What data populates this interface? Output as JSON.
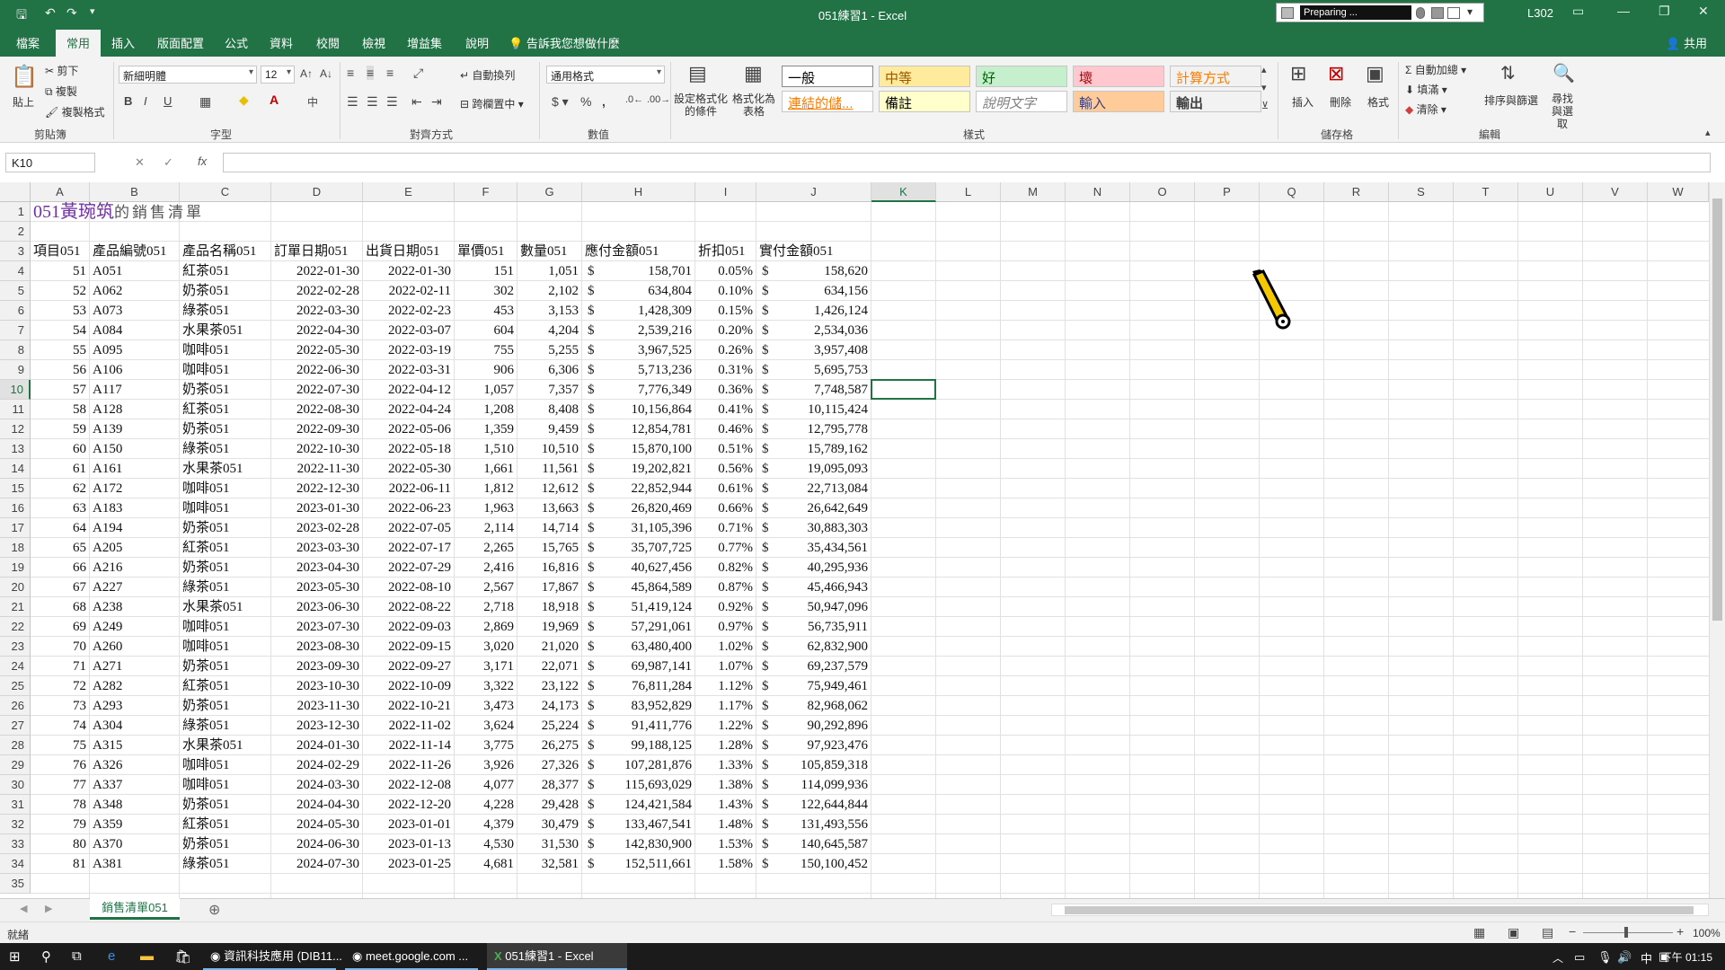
{
  "titlebar": {
    "title": "051練習1 - Excel",
    "preparing": "Preparing ...",
    "user": "L302"
  },
  "tabs": [
    "檔案",
    "常用",
    "插入",
    "版面配置",
    "公式",
    "資料",
    "校閱",
    "檢視",
    "增益集",
    "說明"
  ],
  "tell_me": "告訴我您想做什麼",
  "share": "共用",
  "ribbon": {
    "clipboard": {
      "label": "剪貼簿",
      "paste": "貼上",
      "cut": "剪下",
      "copy": "複製",
      "format_painter": "複製格式"
    },
    "font": {
      "label": "字型",
      "font_name": "新細明體",
      "font_size": "12"
    },
    "alignment": {
      "label": "對齊方式",
      "wrap": "自動換列",
      "merge": "跨欄置中"
    },
    "number": {
      "label": "數值",
      "format": "通用格式"
    },
    "styles": {
      "label": "樣式",
      "conditional": "設定格式化的條件",
      "as_table": "格式化為表格",
      "cells": [
        {
          "text": "一般",
          "bg": "#ffffff",
          "fg": "#000000"
        },
        {
          "text": "中等",
          "bg": "#ffeb9c",
          "fg": "#9c5700"
        },
        {
          "text": "好",
          "bg": "#c6efce",
          "fg": "#006100"
        },
        {
          "text": "壞",
          "bg": "#ffc7ce",
          "fg": "#9c0006"
        },
        {
          "text": "計算方式",
          "bg": "#f2f2f2",
          "fg": "#fa7d00"
        },
        {
          "text": "連結的儲...",
          "bg": "#ffffff",
          "fg": "#fa7d00"
        },
        {
          "text": "備註",
          "bg": "#ffffcc",
          "fg": "#000000"
        },
        {
          "text": "說明文字",
          "bg": "#ffffff",
          "fg": "#7f7f7f"
        },
        {
          "text": "輸入",
          "bg": "#ffcc99",
          "fg": "#3f3f76"
        },
        {
          "text": "輸出",
          "bg": "#f2f2f2",
          "fg": "#3f3f3f"
        }
      ]
    },
    "cells_group": {
      "label": "儲存格",
      "insert": "插入",
      "delete": "刪除",
      "format": "格式"
    },
    "editing": {
      "label": "編輯",
      "autosum": "自動加總",
      "fill": "填滿",
      "clear": "清除",
      "sort": "排序與篩選",
      "find": "尋找與選取"
    }
  },
  "formula_bar": {
    "name_box": "K10",
    "fx": "fx",
    "content": ""
  },
  "columns": [
    "A",
    "B",
    "C",
    "D",
    "E",
    "F",
    "G",
    "H",
    "I",
    "J",
    "K",
    "L",
    "M",
    "N",
    "O",
    "P",
    "Q",
    "R",
    "S",
    "T",
    "U",
    "V",
    "W"
  ],
  "sheet": {
    "title": "051黃琬筑",
    "title_suffix": "的銷售清單",
    "headers": [
      "項目051",
      "產品編號051",
      "產品名稱051",
      "訂單日期051",
      "出貨日期051",
      "單價051",
      "數量051",
      "應付金額051",
      "折扣051",
      "實付金額051"
    ],
    "currency": "$",
    "rows": [
      [
        "51",
        "A051",
        "紅茶051",
        "2022-01-30",
        "2022-01-30",
        "151",
        "1,051",
        "158,701",
        "0.05%",
        "158,620"
      ],
      [
        "52",
        "A062",
        "奶茶051",
        "2022-02-28",
        "2022-02-11",
        "302",
        "2,102",
        "634,804",
        "0.10%",
        "634,156"
      ],
      [
        "53",
        "A073",
        "綠茶051",
        "2022-03-30",
        "2022-02-23",
        "453",
        "3,153",
        "1,428,309",
        "0.15%",
        "1,426,124"
      ],
      [
        "54",
        "A084",
        "水果茶051",
        "2022-04-30",
        "2022-03-07",
        "604",
        "4,204",
        "2,539,216",
        "0.20%",
        "2,534,036"
      ],
      [
        "55",
        "A095",
        "咖啡051",
        "2022-05-30",
        "2022-03-19",
        "755",
        "5,255",
        "3,967,525",
        "0.26%",
        "3,957,408"
      ],
      [
        "56",
        "A106",
        "咖啡051",
        "2022-06-30",
        "2022-03-31",
        "906",
        "6,306",
        "5,713,236",
        "0.31%",
        "5,695,753"
      ],
      [
        "57",
        "A117",
        "奶茶051",
        "2022-07-30",
        "2022-04-12",
        "1,057",
        "7,357",
        "7,776,349",
        "0.36%",
        "7,748,587"
      ],
      [
        "58",
        "A128",
        "紅茶051",
        "2022-08-30",
        "2022-04-24",
        "1,208",
        "8,408",
        "10,156,864",
        "0.41%",
        "10,115,424"
      ],
      [
        "59",
        "A139",
        "奶茶051",
        "2022-09-30",
        "2022-05-06",
        "1,359",
        "9,459",
        "12,854,781",
        "0.46%",
        "12,795,778"
      ],
      [
        "60",
        "A150",
        "綠茶051",
        "2022-10-30",
        "2022-05-18",
        "1,510",
        "10,510",
        "15,870,100",
        "0.51%",
        "15,789,162"
      ],
      [
        "61",
        "A161",
        "水果茶051",
        "2022-11-30",
        "2022-05-30",
        "1,661",
        "11,561",
        "19,202,821",
        "0.56%",
        "19,095,093"
      ],
      [
        "62",
        "A172",
        "咖啡051",
        "2022-12-30",
        "2022-06-11",
        "1,812",
        "12,612",
        "22,852,944",
        "0.61%",
        "22,713,084"
      ],
      [
        "63",
        "A183",
        "咖啡051",
        "2023-01-30",
        "2022-06-23",
        "1,963",
        "13,663",
        "26,820,469",
        "0.66%",
        "26,642,649"
      ],
      [
        "64",
        "A194",
        "奶茶051",
        "2023-02-28",
        "2022-07-05",
        "2,114",
        "14,714",
        "31,105,396",
        "0.71%",
        "30,883,303"
      ],
      [
        "65",
        "A205",
        "紅茶051",
        "2023-03-30",
        "2022-07-17",
        "2,265",
        "15,765",
        "35,707,725",
        "0.77%",
        "35,434,561"
      ],
      [
        "66",
        "A216",
        "奶茶051",
        "2023-04-30",
        "2022-07-29",
        "2,416",
        "16,816",
        "40,627,456",
        "0.82%",
        "40,295,936"
      ],
      [
        "67",
        "A227",
        "綠茶051",
        "2023-05-30",
        "2022-08-10",
        "2,567",
        "17,867",
        "45,864,589",
        "0.87%",
        "45,466,943"
      ],
      [
        "68",
        "A238",
        "水果茶051",
        "2023-06-30",
        "2022-08-22",
        "2,718",
        "18,918",
        "51,419,124",
        "0.92%",
        "50,947,096"
      ],
      [
        "69",
        "A249",
        "咖啡051",
        "2023-07-30",
        "2022-09-03",
        "2,869",
        "19,969",
        "57,291,061",
        "0.97%",
        "56,735,911"
      ],
      [
        "70",
        "A260",
        "咖啡051",
        "2023-08-30",
        "2022-09-15",
        "3,020",
        "21,020",
        "63,480,400",
        "1.02%",
        "62,832,900"
      ],
      [
        "71",
        "A271",
        "奶茶051",
        "2023-09-30",
        "2022-09-27",
        "3,171",
        "22,071",
        "69,987,141",
        "1.07%",
        "69,237,579"
      ],
      [
        "72",
        "A282",
        "紅茶051",
        "2023-10-30",
        "2022-10-09",
        "3,322",
        "23,122",
        "76,811,284",
        "1.12%",
        "75,949,461"
      ],
      [
        "73",
        "A293",
        "奶茶051",
        "2023-11-30",
        "2022-10-21",
        "3,473",
        "24,173",
        "83,952,829",
        "1.17%",
        "82,968,062"
      ],
      [
        "74",
        "A304",
        "綠茶051",
        "2023-12-30",
        "2022-11-02",
        "3,624",
        "25,224",
        "91,411,776",
        "1.22%",
        "90,292,896"
      ],
      [
        "75",
        "A315",
        "水果茶051",
        "2024-01-30",
        "2022-11-14",
        "3,775",
        "26,275",
        "99,188,125",
        "1.28%",
        "97,923,476"
      ],
      [
        "76",
        "A326",
        "咖啡051",
        "2024-02-29",
        "2022-11-26",
        "3,926",
        "27,326",
        "107,281,876",
        "1.33%",
        "105,859,318"
      ],
      [
        "77",
        "A337",
        "咖啡051",
        "2024-03-30",
        "2022-12-08",
        "4,077",
        "28,377",
        "115,693,029",
        "1.38%",
        "114,099,936"
      ],
      [
        "78",
        "A348",
        "奶茶051",
        "2024-04-30",
        "2022-12-20",
        "4,228",
        "29,428",
        "124,421,584",
        "1.43%",
        "122,644,844"
      ],
      [
        "79",
        "A359",
        "紅茶051",
        "2024-05-30",
        "2023-01-01",
        "4,379",
        "30,479",
        "133,467,541",
        "1.48%",
        "131,493,556"
      ],
      [
        "80",
        "A370",
        "奶茶051",
        "2024-06-30",
        "2023-01-13",
        "4,530",
        "31,530",
        "142,830,900",
        "1.53%",
        "140,645,587"
      ],
      [
        "81",
        "A381",
        "綠茶051",
        "2024-07-30",
        "2023-01-25",
        "4,681",
        "32,581",
        "152,511,661",
        "1.58%",
        "150,100,452"
      ]
    ]
  },
  "sheet_tab": "銷售清單051",
  "status": {
    "ready": "就緒",
    "zoom": "100%"
  },
  "taskbar": {
    "items": [
      "資訊科技應用 (DIB11...",
      "meet.google.com ...",
      "051練習1 - Excel"
    ],
    "ime": "中",
    "clock": "下午 01:15"
  },
  "colors": {
    "excel_green": "#217346",
    "title_purple": "#7030a0"
  }
}
